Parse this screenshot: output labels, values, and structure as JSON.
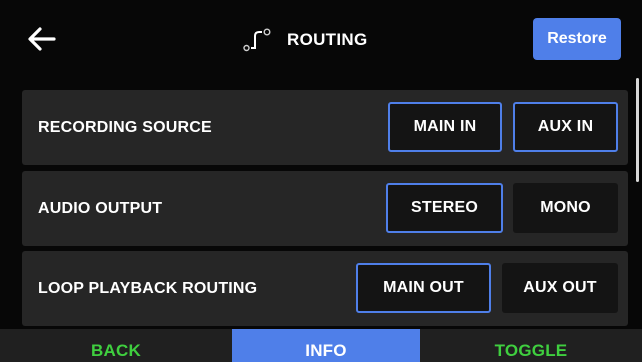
{
  "header": {
    "title": "ROUTING",
    "back_icon": "back-arrow-icon",
    "title_icon": "routing-icon",
    "restore_label": "Restore"
  },
  "rows": [
    {
      "label": "RECORDING SOURCE",
      "options": [
        {
          "label": "MAIN IN",
          "selected": true
        },
        {
          "label": "AUX IN",
          "selected": true
        }
      ]
    },
    {
      "label": "AUDIO OUTPUT",
      "options": [
        {
          "label": "STEREO",
          "selected": true
        },
        {
          "label": "MONO",
          "selected": false
        }
      ]
    },
    {
      "label": "LOOP PLAYBACK ROUTING",
      "options": [
        {
          "label": "MAIN OUT",
          "selected": true
        },
        {
          "label": "AUX OUT",
          "selected": false
        }
      ]
    }
  ],
  "bottom_bar": {
    "back_label": "BACK",
    "info_label": "INFO",
    "toggle_label": "TOGGLE"
  },
  "colors": {
    "accent": "#4f7fe9",
    "softkey_text": "#3fcf3f",
    "row_background": "#262626",
    "option_background": "#141414"
  }
}
